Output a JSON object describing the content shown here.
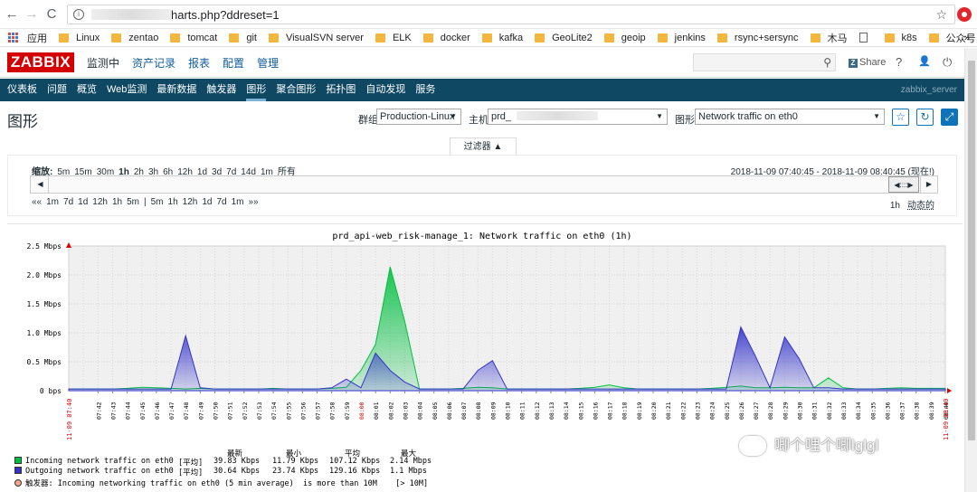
{
  "browser": {
    "url": "harts.php?ddreset=1",
    "back": "←",
    "forward": "→",
    "reload": "C"
  },
  "bookmarks": [
    {
      "label": "应用",
      "kind": "apps"
    },
    {
      "label": "Linux",
      "kind": "folder"
    },
    {
      "label": "zentao",
      "kind": "folder"
    },
    {
      "label": "tomcat",
      "kind": "folder"
    },
    {
      "label": "git",
      "kind": "folder"
    },
    {
      "label": "VisualSVN server",
      "kind": "folder"
    },
    {
      "label": "ELK",
      "kind": "folder"
    },
    {
      "label": "docker",
      "kind": "folder"
    },
    {
      "label": "kafka",
      "kind": "folder"
    },
    {
      "label": "GeoLite2",
      "kind": "folder"
    },
    {
      "label": "geoip",
      "kind": "folder"
    },
    {
      "label": "jenkins",
      "kind": "folder"
    },
    {
      "label": "rsync+sersync",
      "kind": "folder"
    },
    {
      "label": "木马",
      "kind": "folder"
    },
    {
      "label": "",
      "kind": "page"
    },
    {
      "label": "k8s",
      "kind": "folder"
    },
    {
      "label": "公众号",
      "kind": "folder"
    }
  ],
  "bookmarks_more": "»",
  "zabbix": {
    "logo": "ZABBIX",
    "menu": [
      "监测中",
      "资产记录",
      "报表",
      "配置",
      "管理"
    ],
    "share": "Share",
    "help": "?",
    "user": "👤",
    "power": "⏻"
  },
  "submenu": {
    "items": [
      "仪表板",
      "问题",
      "概览",
      "Web监测",
      "最新数据",
      "触发器",
      "图形",
      "聚合图形",
      "拓扑图",
      "自动发现",
      "服务"
    ],
    "active": 6,
    "server": "zabbix_server"
  },
  "page": {
    "title": "图形",
    "group_label": "群组",
    "group": "Production-Linux",
    "host_label": "主机",
    "host": "prd_",
    "graph_label": "图形",
    "graph": "Network traffic on eth0"
  },
  "filter": {
    "tab": "过滤器 ▲",
    "zoom_label": "缩放:",
    "zoom": [
      "5m",
      "15m",
      "30m",
      "1h",
      "2h",
      "3h",
      "6h",
      "12h",
      "1d",
      "3d",
      "7d",
      "14d",
      "1m",
      "所有"
    ],
    "zoom_active": "1h",
    "range": "2018-11-09 07:40:45 - 2018-11-09 08:40:45 (现在!)",
    "shift_left": [
      "««",
      "1m",
      "7d",
      "1d",
      "12h",
      "1h",
      "5m",
      "|",
      "5m",
      "1h",
      "12h",
      "1d",
      "7d",
      "1m",
      "»»"
    ],
    "period": "1h",
    "mode": "动态的"
  },
  "chart_data": {
    "type": "area",
    "title": "prd_api-web_risk-manage_1: Network traffic on eth0  (1h)",
    "ylabel": "",
    "ylim": [
      0,
      2.5
    ],
    "yticks": [
      "2.5 Mbps",
      "2.0 Mbps",
      "1.5 Mbps",
      "1.0 Mbps",
      "0.5 Mbps",
      "0 bps"
    ],
    "xticks": [
      "07:42",
      "07:43",
      "07:44",
      "07:45",
      "07:46",
      "07:47",
      "07:48",
      "07:49",
      "07:50",
      "07:51",
      "07:52",
      "07:53",
      "07:54",
      "07:55",
      "07:56",
      "07:57",
      "07:58",
      "07:59",
      "08:00",
      "08:01",
      "08:02",
      "08:03",
      "08:04",
      "08:05",
      "08:06",
      "08:07",
      "08:08",
      "08:09",
      "08:10",
      "08:11",
      "08:12",
      "08:13",
      "08:14",
      "08:15",
      "08:16",
      "08:17",
      "08:18",
      "08:19",
      "08:20",
      "08:21",
      "08:22",
      "08:23",
      "08:24",
      "08:25",
      "08:26",
      "08:27",
      "08:28",
      "08:29",
      "08:30",
      "08:31",
      "08:32",
      "08:33",
      "08:34",
      "08:35",
      "08:36",
      "08:37",
      "08:38",
      "08:39",
      "08:40"
    ],
    "red_ticks": [
      "11-09 07:40",
      "08:00",
      "11-09 08:40"
    ],
    "x": [
      0,
      1,
      2,
      3,
      4,
      5,
      6,
      7,
      8,
      9,
      10,
      11,
      12,
      13,
      14,
      15,
      16,
      17,
      18,
      19,
      20,
      21,
      22,
      23,
      24,
      25,
      26,
      27,
      28,
      29,
      30,
      31,
      32,
      33,
      34,
      35,
      36,
      37,
      38,
      39,
      40,
      41,
      42,
      43,
      44,
      45,
      46,
      47,
      48,
      49,
      50,
      51,
      52,
      53,
      54,
      55,
      56,
      57,
      58,
      59,
      60
    ],
    "series": [
      {
        "name": "Incoming network traffic on eth0",
        "color": "#00c040",
        "values": [
          0.03,
          0.03,
          0.03,
          0.03,
          0.04,
          0.06,
          0.05,
          0.04,
          0.03,
          0.04,
          0.03,
          0.03,
          0.03,
          0.03,
          0.04,
          0.03,
          0.03,
          0.03,
          0.04,
          0.06,
          0.35,
          0.8,
          2.14,
          1.2,
          0.03,
          0.03,
          0.03,
          0.04,
          0.06,
          0.05,
          0.03,
          0.03,
          0.03,
          0.03,
          0.03,
          0.04,
          0.06,
          0.1,
          0.05,
          0.03,
          0.03,
          0.03,
          0.03,
          0.03,
          0.04,
          0.06,
          0.08,
          0.05,
          0.05,
          0.06,
          0.05,
          0.05,
          0.22,
          0.05,
          0.03,
          0.03,
          0.04,
          0.05,
          0.04,
          0.04,
          0.04
        ]
      },
      {
        "name": "Outgoing network traffic on eth0",
        "color": "#3333cc",
        "values": [
          0.03,
          0.03,
          0.03,
          0.03,
          0.03,
          0.03,
          0.03,
          0.03,
          0.95,
          0.05,
          0.03,
          0.03,
          0.03,
          0.03,
          0.03,
          0.03,
          0.03,
          0.03,
          0.05,
          0.2,
          0.05,
          0.65,
          0.35,
          0.15,
          0.03,
          0.03,
          0.03,
          0.03,
          0.35,
          0.52,
          0.03,
          0.03,
          0.03,
          0.03,
          0.03,
          0.03,
          0.03,
          0.03,
          0.03,
          0.03,
          0.03,
          0.03,
          0.03,
          0.03,
          0.03,
          0.03,
          1.1,
          0.6,
          0.05,
          0.93,
          0.55,
          0.05,
          0.05,
          0.03,
          0.03,
          0.03,
          0.03,
          0.03,
          0.03,
          0.03,
          0.03
        ]
      }
    ],
    "legend_headers": [
      "最新",
      "最小",
      "平均",
      "最大"
    ],
    "legend_rows": [
      {
        "name": "Incoming network traffic on eth0",
        "func": "[平均]",
        "last": "39.83 Kbps",
        "min": "11.79 Kbps",
        "avg": "107.12 Kbps",
        "max": "2.14 Mbps"
      },
      {
        "name": "Outgoing network traffic on eth0",
        "func": "[平均]",
        "last": "30.64 Kbps",
        "min": "23.74 Kbps",
        "avg": "129.16 Kbps",
        "max": "1.1 Mbps"
      }
    ],
    "trigger": "触发器: Incoming networking traffic on eth0 (5 min average)  is more than 10M    [> 10M]"
  },
  "watermark": "唧个哩个唧lglgl"
}
